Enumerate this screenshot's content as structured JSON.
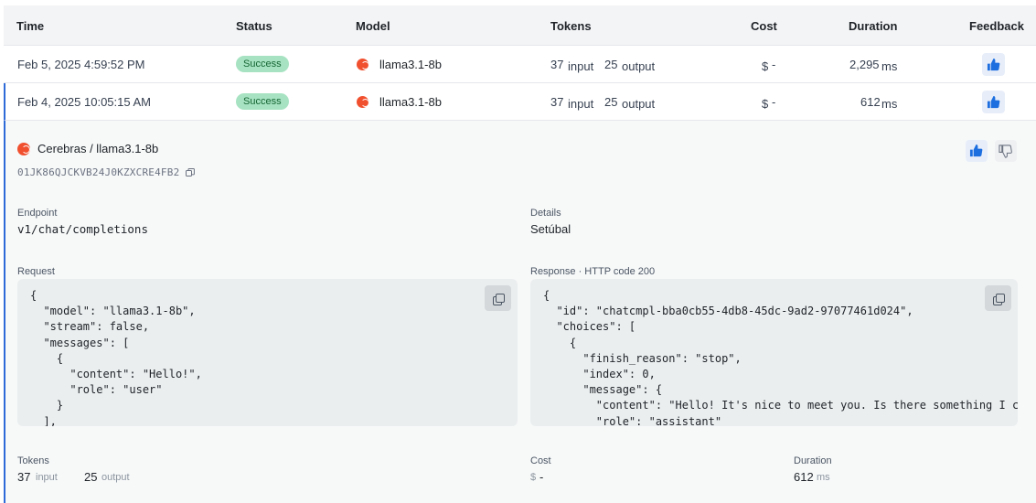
{
  "columns": [
    "Time",
    "Status",
    "Model",
    "Tokens",
    "Cost",
    "Duration",
    "Feedback"
  ],
  "rows": [
    {
      "time": "Feb 5, 2025 4:59:52 PM",
      "status": "Success",
      "model": "llama3.1-8b",
      "input_tokens": "37",
      "input_label": "input",
      "output_tokens": "25",
      "output_label": "output",
      "cost_symbol": "$",
      "cost": "-",
      "duration": "2,295",
      "duration_unit": "ms"
    },
    {
      "time": "Feb 4, 2025 10:05:15 AM",
      "status": "Success",
      "model": "llama3.1-8b",
      "input_tokens": "37",
      "input_label": "input",
      "output_tokens": "25",
      "output_label": "output",
      "cost_symbol": "$",
      "cost": "-",
      "duration": "612",
      "duration_unit": "ms"
    }
  ],
  "detail": {
    "title": "Cerebras / llama3.1-8b",
    "request_id": "01JK86QJCKVB24J0KZXCRE4FB2",
    "endpoint_label": "Endpoint",
    "endpoint": "v1/chat/completions",
    "details_label": "Details",
    "details": "Setúbal",
    "request_label": "Request",
    "request_body": "{\n  \"model\": \"llama3.1-8b\",\n  \"stream\": false,\n  \"messages\": [\n    {\n      \"content\": \"Hello!\",\n      \"role\": \"user\"\n    }\n  ],",
    "response_label": "Response · HTTP code 200",
    "response_body": "{\n  \"id\": \"chatcmpl-bba0cb55-4db8-45dc-9ad2-97077461d024\",\n  \"choices\": [\n    {\n      \"finish_reason\": \"stop\",\n      \"index\": 0,\n      \"message\": {\n        \"content\": \"Hello! It's nice to meet you. Is there something I can h\n        \"role\": \"assistant\"",
    "tokens_label": "Tokens",
    "input_tokens": "37",
    "input_label": "input",
    "output_tokens": "25",
    "output_label": "output",
    "cost_label": "Cost",
    "cost_symbol": "$",
    "cost": "-",
    "duration_label": "Duration",
    "duration": "612",
    "duration_unit": "ms"
  },
  "colors": {
    "accent": "#2f6bd8",
    "success_bg": "#a7e3c2",
    "success_text": "#166534",
    "brand": "#f1502f"
  },
  "icons": {
    "provider": "cerebras-logo-icon",
    "like": "thumbs-up-icon",
    "dislike": "thumbs-down-icon",
    "copy": "copy-icon"
  }
}
